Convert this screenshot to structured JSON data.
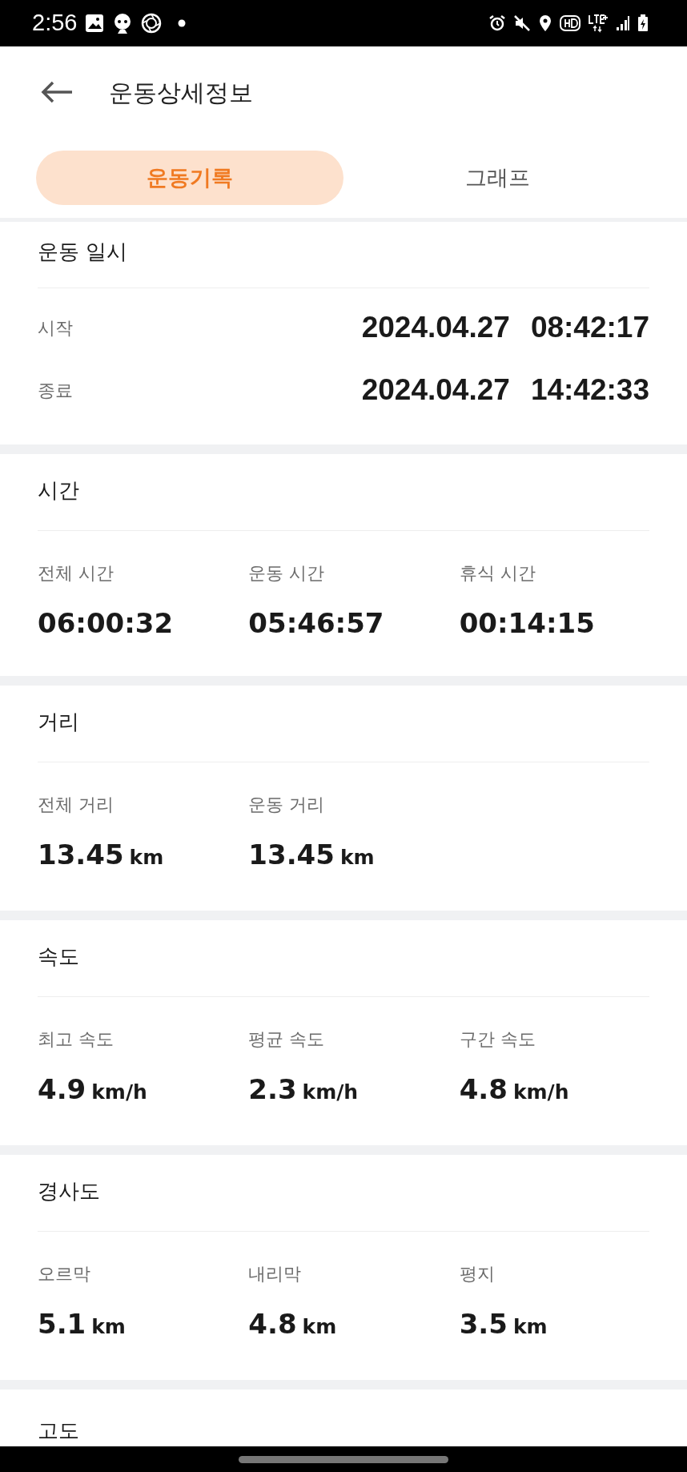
{
  "status_bar": {
    "time": "2:56"
  },
  "header": {
    "title": "운동상세정보"
  },
  "tabs": [
    {
      "label": "운동기록",
      "selected": true
    },
    {
      "label": "그래프",
      "selected": false
    }
  ],
  "datetime_section": {
    "title": "운동 일시",
    "rows": [
      {
        "label": "시작",
        "date": "2024.04.27",
        "time": "08:42:17"
      },
      {
        "label": "종료",
        "date": "2024.04.27",
        "time": "14:42:33"
      }
    ]
  },
  "sections": [
    {
      "title": "시간",
      "stats": [
        {
          "label": "전체 시간",
          "value": "06:00:32"
        },
        {
          "label": "운동 시간",
          "value": "05:46:57"
        },
        {
          "label": "휴식 시간",
          "value": "00:14:15"
        }
      ]
    },
    {
      "title": "거리",
      "stats": [
        {
          "label": "전체 거리",
          "value": "13.45",
          "unit": "km"
        },
        {
          "label": "운동 거리",
          "value": "13.45",
          "unit": "km"
        }
      ]
    },
    {
      "title": "속도",
      "stats": [
        {
          "label": "최고 속도",
          "value": "4.9",
          "unit": "km/h"
        },
        {
          "label": "평균 속도",
          "value": "2.3",
          "unit": "km/h"
        },
        {
          "label": "구간 속도",
          "value": "4.8",
          "unit": "km/h"
        }
      ]
    },
    {
      "title": "경사도",
      "stats": [
        {
          "label": "오르막",
          "value": "5.1",
          "unit": "km"
        },
        {
          "label": "내리막",
          "value": "4.8",
          "unit": "km"
        },
        {
          "label": "평지",
          "value": "3.5",
          "unit": "km"
        }
      ]
    }
  ],
  "partial_section": {
    "title": "고도"
  }
}
